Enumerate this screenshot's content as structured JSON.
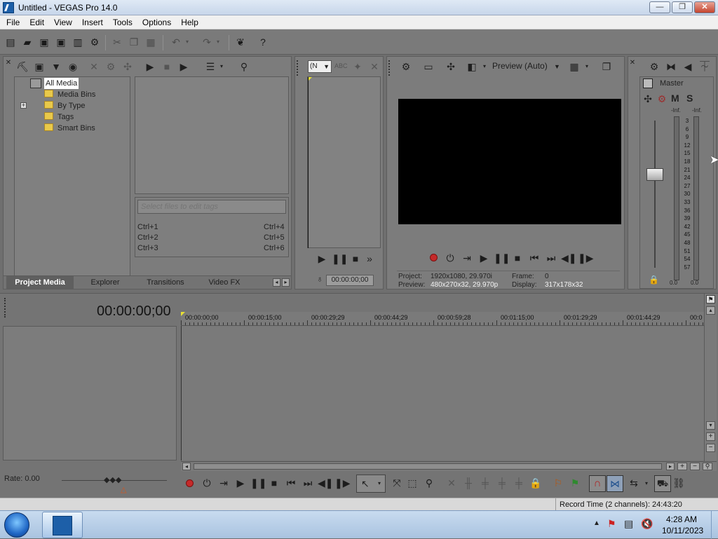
{
  "window": {
    "title": "Untitled - VEGAS Pro 14.0",
    "min_label": "—",
    "max_label": "❐",
    "close_label": "✕"
  },
  "menu": [
    {
      "label": "File"
    },
    {
      "label": "Edit"
    },
    {
      "label": "View"
    },
    {
      "label": "Insert"
    },
    {
      "label": "Tools"
    },
    {
      "label": "Options"
    },
    {
      "label": "Help"
    }
  ],
  "toolbar_icons": [
    "new-icon",
    "open-icon",
    "save-icon",
    "save-as-icon",
    "render-icon",
    "properties-icon",
    "cut-icon",
    "copy-icon",
    "paste-icon",
    "undo-icon",
    "redo-icon",
    "vegas-icon",
    "help-icon"
  ],
  "media": {
    "tree": [
      {
        "label": "All Media",
        "selected": true
      },
      {
        "label": "Media Bins"
      },
      {
        "label": "By Type",
        "expander": "+"
      },
      {
        "label": "Tags"
      },
      {
        "label": "Smart Bins"
      }
    ],
    "tag_placeholder": "Select files to edit tags",
    "shortcuts": [
      {
        "left": "Ctrl+1",
        "right": "Ctrl+4"
      },
      {
        "left": "Ctrl+2",
        "right": "Ctrl+5"
      },
      {
        "left": "Ctrl+3",
        "right": "Ctrl+6"
      }
    ],
    "tabs": [
      "Project Media",
      "Explorer",
      "Transitions",
      "Video FX"
    ]
  },
  "trimmer": {
    "dropdown": "(N",
    "timecode": "00:00:00;00"
  },
  "preview": {
    "quality": "Preview (Auto)",
    "project_label": "Project:",
    "project_value": "1920x1080, 29.970i",
    "frame_label": "Frame:",
    "frame_value": "0",
    "preview_label": "Preview:",
    "preview_value": "480x270x32, 29.970p",
    "display_label": "Display:",
    "display_value": "317x178x32"
  },
  "mixer": {
    "master_label": "Master",
    "m_label": "M",
    "s_label": "S",
    "peak_left": "-Inf.",
    "peak_right": "-Inf.",
    "scale": [
      "3",
      "6",
      "9",
      "12",
      "15",
      "18",
      "21",
      "24",
      "27",
      "30",
      "33",
      "36",
      "39",
      "42",
      "45",
      "48",
      "51",
      "54",
      "57"
    ],
    "bottom_left": "0.0",
    "bottom_right": "0.0"
  },
  "timeline": {
    "cursor": "00:00:00;00",
    "ruler": [
      "00:00:00;00",
      "00:00:15;00",
      "00:00:29;29",
      "00:00:44;29",
      "00:00:59;28",
      "00:01:15;00",
      "00:01:29;29",
      "00:01:44;29",
      "00:0"
    ],
    "rate": "Rate: 0.00",
    "record_time": "Record Time (2 channels): 24:43:20"
  },
  "taskbar": {
    "time": "4:28 AM",
    "date": "10/11/2023"
  }
}
